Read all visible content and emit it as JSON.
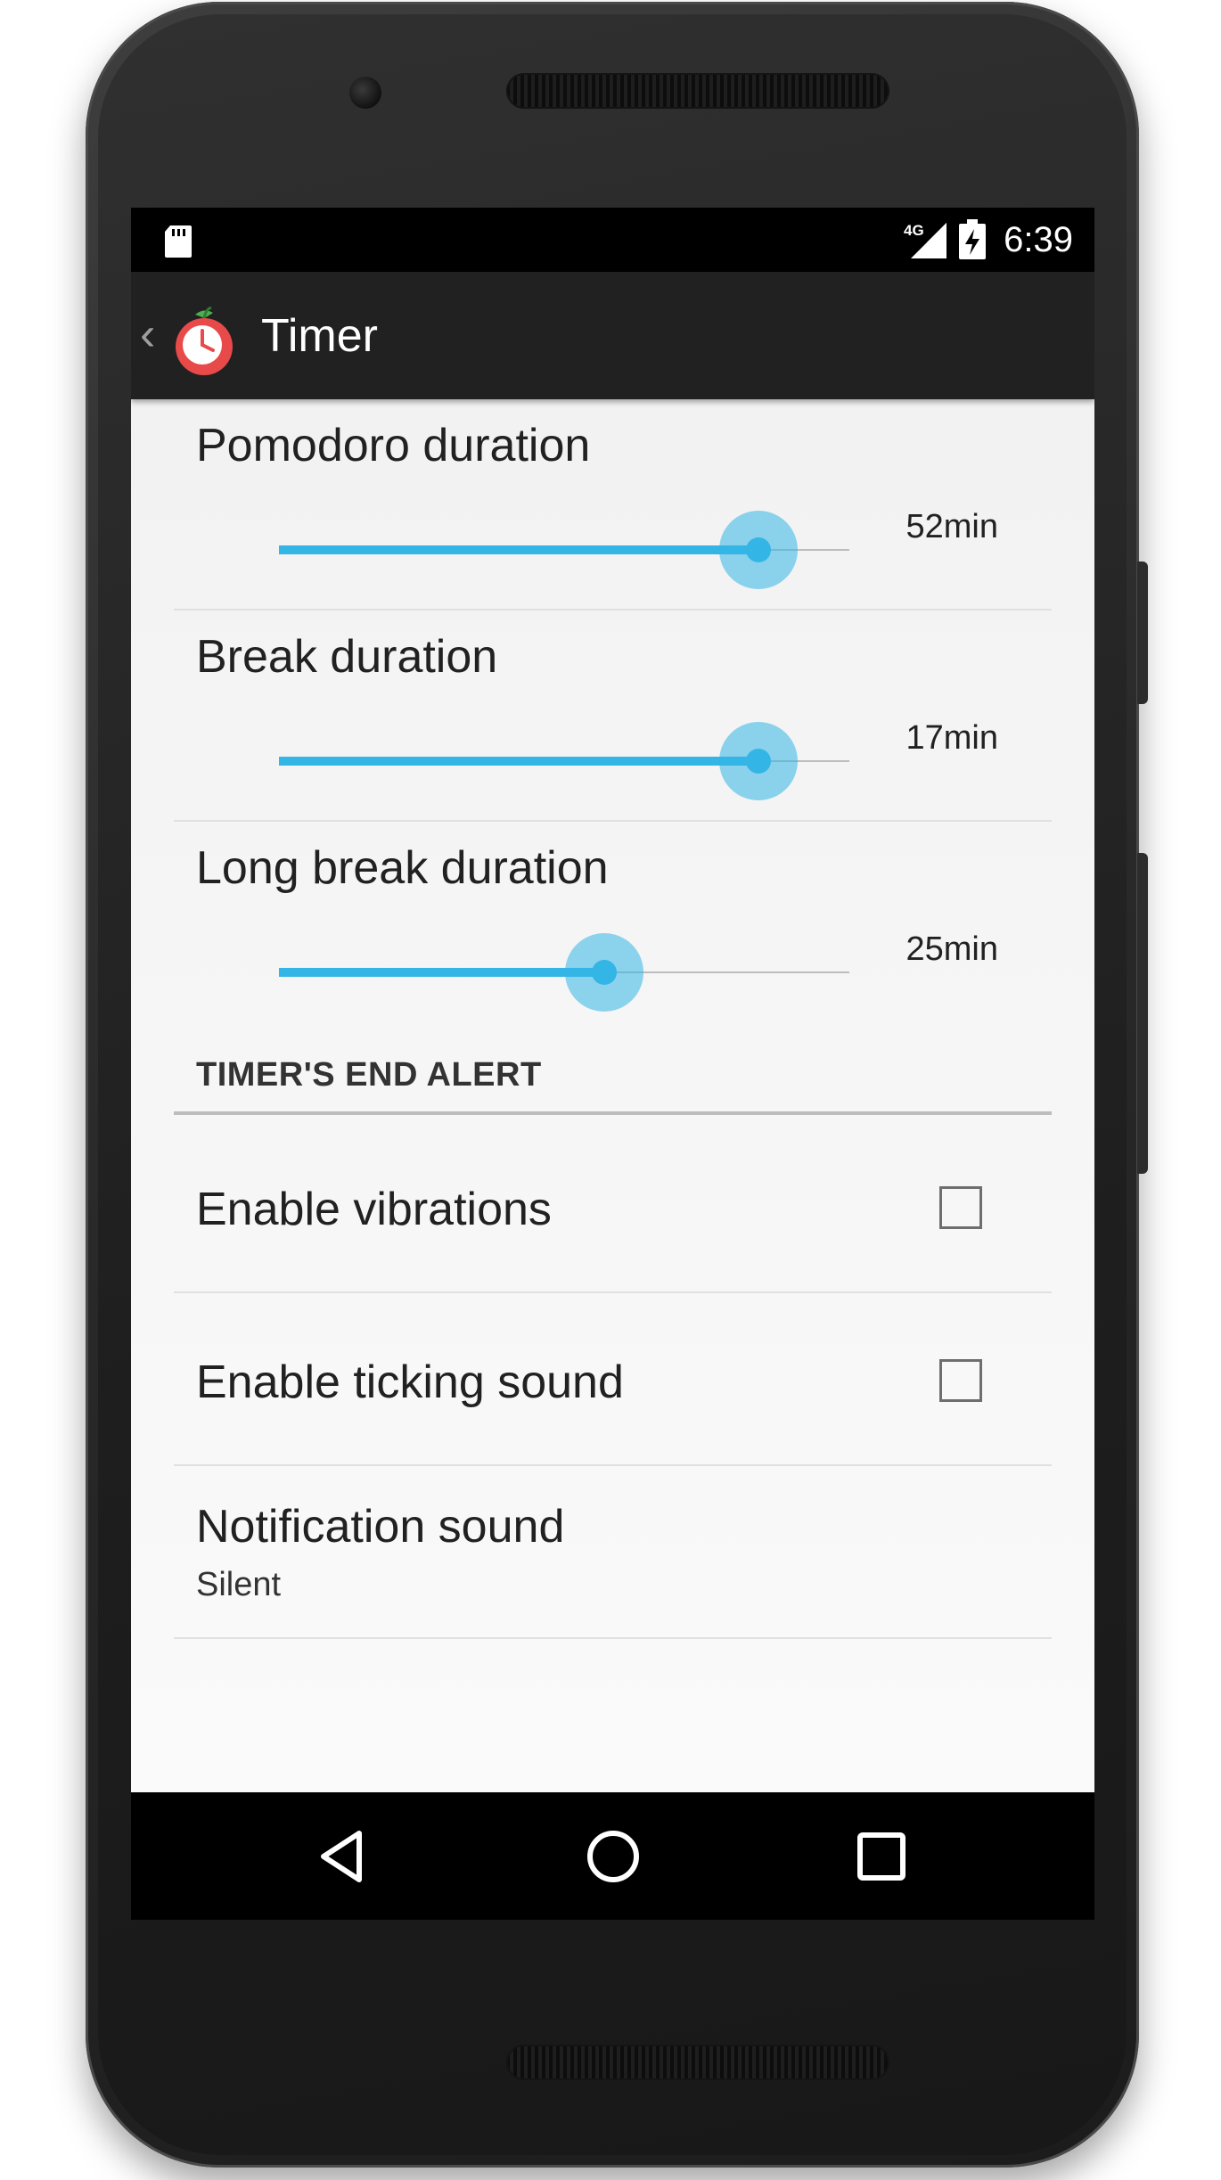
{
  "status_bar": {
    "network_label": "4G",
    "time": "6:39",
    "icons": [
      "sd-card-icon",
      "signal-icon",
      "battery-charging-icon"
    ]
  },
  "app_bar": {
    "title": "Timer",
    "icons": [
      "up-caret-icon",
      "tomato-timer-app-icon"
    ]
  },
  "preferences": {
    "pomodoro": {
      "title": "Pomodoro duration",
      "value_label": "52min",
      "slider_fraction": 0.84
    },
    "break": {
      "title": "Break duration",
      "value_label": "17min",
      "slider_fraction": 0.84
    },
    "long_break": {
      "title": "Long break duration",
      "value_label": "25min",
      "slider_fraction": 0.57
    },
    "alert_category": {
      "title": "TIMER'S END ALERT"
    },
    "vibrations": {
      "title": "Enable vibrations",
      "checked": false
    },
    "ticking": {
      "title": "Enable ticking sound",
      "checked": false
    },
    "notification": {
      "title": "Notification sound",
      "summary": "Silent"
    }
  },
  "nav_bar": {
    "icons": [
      "back-icon",
      "home-icon",
      "recents-icon"
    ]
  },
  "colors": {
    "accent": "#33b5e5",
    "app_bar": "#212121",
    "status_bar": "#000000"
  }
}
